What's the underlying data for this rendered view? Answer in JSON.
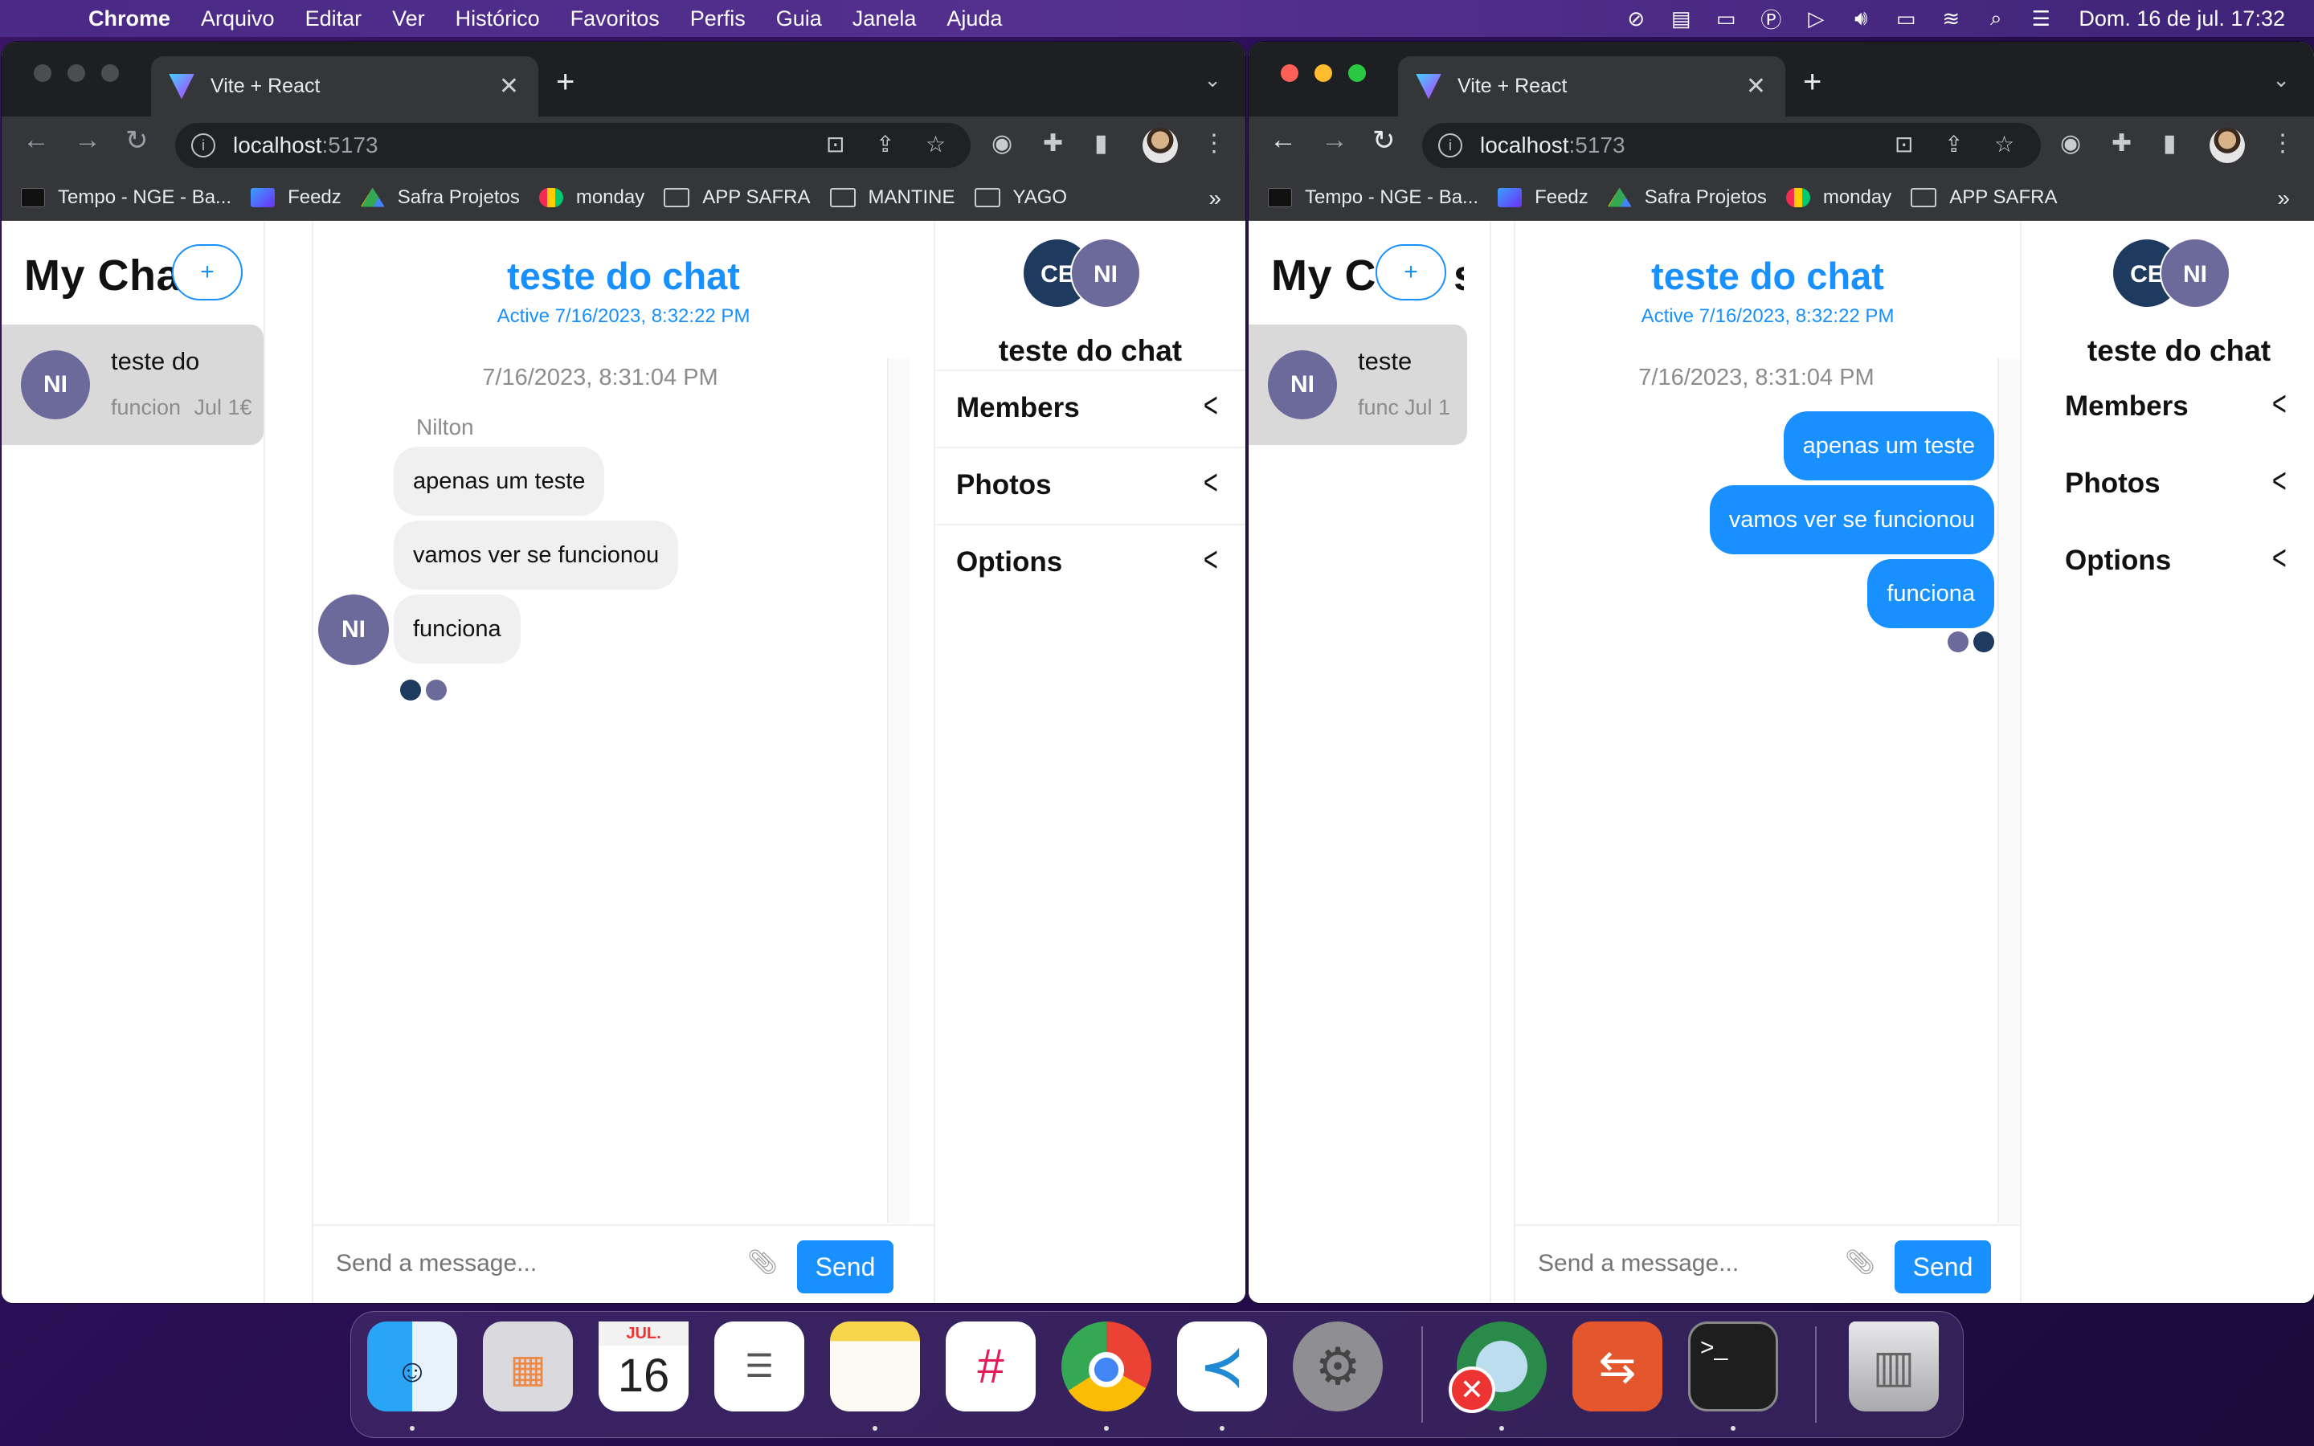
{
  "menubar": {
    "app": "Chrome",
    "items": [
      "Arquivo",
      "Editar",
      "Ver",
      "Histórico",
      "Favoritos",
      "Perfis",
      "Guia",
      "Janela",
      "Ajuda"
    ],
    "clock": "Dom. 16 de jul.  17:32"
  },
  "browser": {
    "tab_title": "Vite + React",
    "url_host": "localhost",
    "url_port": ":5173",
    "bookmarks": [
      "Tempo - NGE - Ba...",
      "Feedz",
      "Safra Projetos",
      "monday",
      "APP SAFRA",
      "MANTINE",
      "YAGO"
    ],
    "bookmarks_more": "»"
  },
  "chat": {
    "header": "My Chats",
    "header_left_visible": "My Cha",
    "header_right_visible": "My C",
    "header_right_tail": "s",
    "new_button": "+",
    "card": {
      "avatar": "NI",
      "title_left": "teste do",
      "title_right": "teste",
      "preview_left": "funcion",
      "preview_right": "func",
      "date_left": "Jul 1€",
      "date_right": "Jul 1"
    },
    "title": "teste do chat",
    "active": "Active 7/16/2023, 8:32:22 PM",
    "timestamp": "7/16/2023, 8:31:04 PM",
    "sender": "Nilton",
    "sender_avatar": "NI",
    "messages": [
      "apenas um teste",
      "vamos ver se funcionou",
      "funciona"
    ],
    "composer_placeholder": "Send a message...",
    "send_label": "Send",
    "members_avatars": [
      "CE",
      "NI"
    ],
    "settings_title": "teste do chat",
    "sections": [
      "Members",
      "Photos",
      "Options"
    ]
  },
  "dock": {
    "calendar_month": "JUL.",
    "calendar_day": "16",
    "apps": [
      "finder-icon",
      "launchpad-icon",
      "calendar-icon",
      "reminders-icon",
      "notes-icon",
      "slack-icon",
      "chrome-icon",
      "vscode-icon",
      "system-settings-icon",
      "network-app-icon",
      "remote-desktop-icon",
      "terminal-icon",
      "trash-icon"
    ]
  },
  "colors": {
    "accent": "#1890ff",
    "avatar_ni": "#6b6a9b",
    "avatar_ce": "#1f3a5f"
  }
}
